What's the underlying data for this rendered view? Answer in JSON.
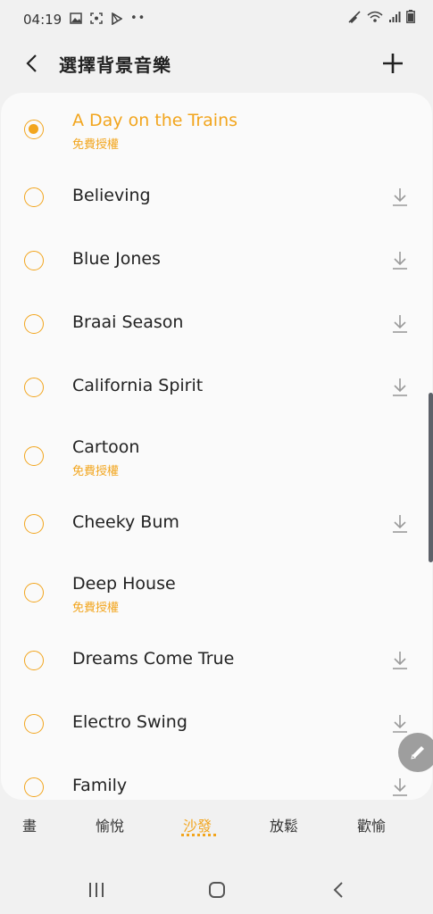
{
  "status": {
    "time": "04:19"
  },
  "header": {
    "title": "選擇背景音樂"
  },
  "songs": [
    {
      "title": "A Day on the Trains",
      "subtitle": "免費授權",
      "selected": true
    },
    {
      "title": "Believing",
      "subtitle": "",
      "selected": false
    },
    {
      "title": "Blue Jones",
      "subtitle": "",
      "selected": false
    },
    {
      "title": "Braai Season",
      "subtitle": "",
      "selected": false
    },
    {
      "title": "California Spirit",
      "subtitle": "",
      "selected": false
    },
    {
      "title": "Cartoon",
      "subtitle": "免費授權",
      "selected": false
    },
    {
      "title": "Cheeky Bum",
      "subtitle": "",
      "selected": false
    },
    {
      "title": "Deep House",
      "subtitle": "免費授權",
      "selected": false
    },
    {
      "title": "Dreams Come True",
      "subtitle": "",
      "selected": false
    },
    {
      "title": "Electro Swing",
      "subtitle": "",
      "selected": false
    },
    {
      "title": "Family",
      "subtitle": "",
      "selected": false
    }
  ],
  "tabs": [
    {
      "label": "畫",
      "active": false
    },
    {
      "label": "愉悅",
      "active": false
    },
    {
      "label": "沙發",
      "active": true
    },
    {
      "label": "放鬆",
      "active": false
    },
    {
      "label": "歡愉",
      "active": false
    }
  ],
  "colors": {
    "accent": "#f2a51d",
    "background": "#f1f1f1",
    "card": "#fafafa"
  },
  "icons": {
    "back": "chevron-left-icon",
    "add": "plus-icon",
    "download": "download-icon",
    "edit": "pencil-icon"
  }
}
